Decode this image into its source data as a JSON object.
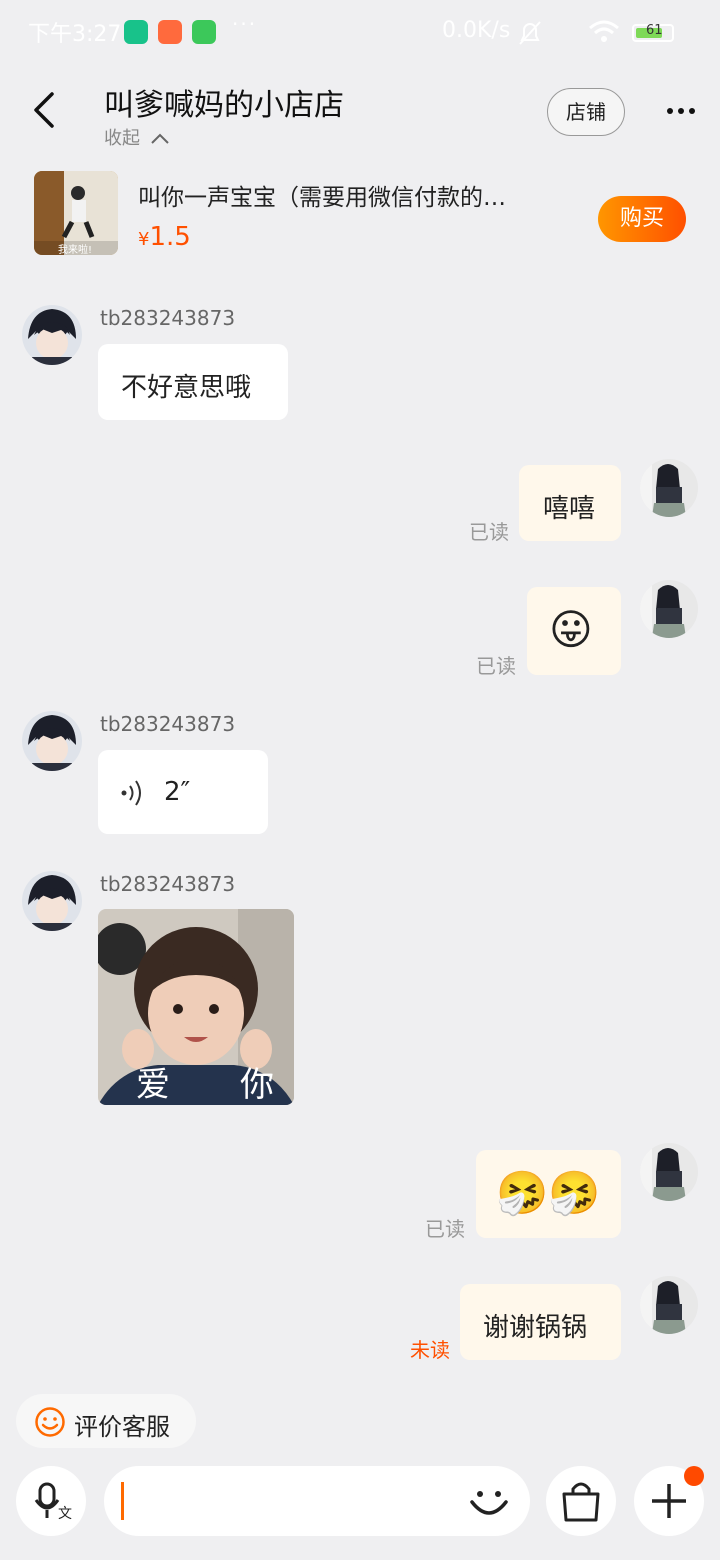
{
  "status_bar": {
    "time": "下午3:27",
    "dots": "···",
    "net_speed": "0.0K/s",
    "battery": "61",
    "app_icon_colors": [
      "#18c28a",
      "#ff6a3d",
      "#3cc85a"
    ]
  },
  "header": {
    "title": "叫爹喊妈的小店店",
    "collapse_label": "收起",
    "store_button": "店铺"
  },
  "product": {
    "image_caption": "我来啦!",
    "name": "叫你一声宝宝（需要用微信付款的…",
    "currency": "¥",
    "price": "1.5",
    "buy_button": "购买"
  },
  "messages": [
    {
      "side": "left",
      "sender": "tb283243873",
      "type": "text",
      "text": "不好意思哦"
    },
    {
      "side": "right",
      "type": "text",
      "text": "嘻嘻",
      "status": "已读"
    },
    {
      "side": "right",
      "type": "emoji",
      "emoji": "😛",
      "status": "已读"
    },
    {
      "side": "left",
      "sender": "tb283243873",
      "type": "voice",
      "duration": "2″"
    },
    {
      "side": "left",
      "sender": "tb283243873",
      "type": "image",
      "caption_left": "爱",
      "caption_right": "你"
    },
    {
      "side": "right",
      "type": "emoji",
      "emoji": "🤧🤧",
      "status": "已读"
    },
    {
      "side": "right",
      "type": "text",
      "text": "谢谢锅锅",
      "status": "未读"
    }
  ],
  "footer": {
    "rate_button": "评价客服"
  },
  "colors": {
    "accent": "#ff5000",
    "my_bubble": "#fff8eb",
    "background": "#efeff1"
  }
}
